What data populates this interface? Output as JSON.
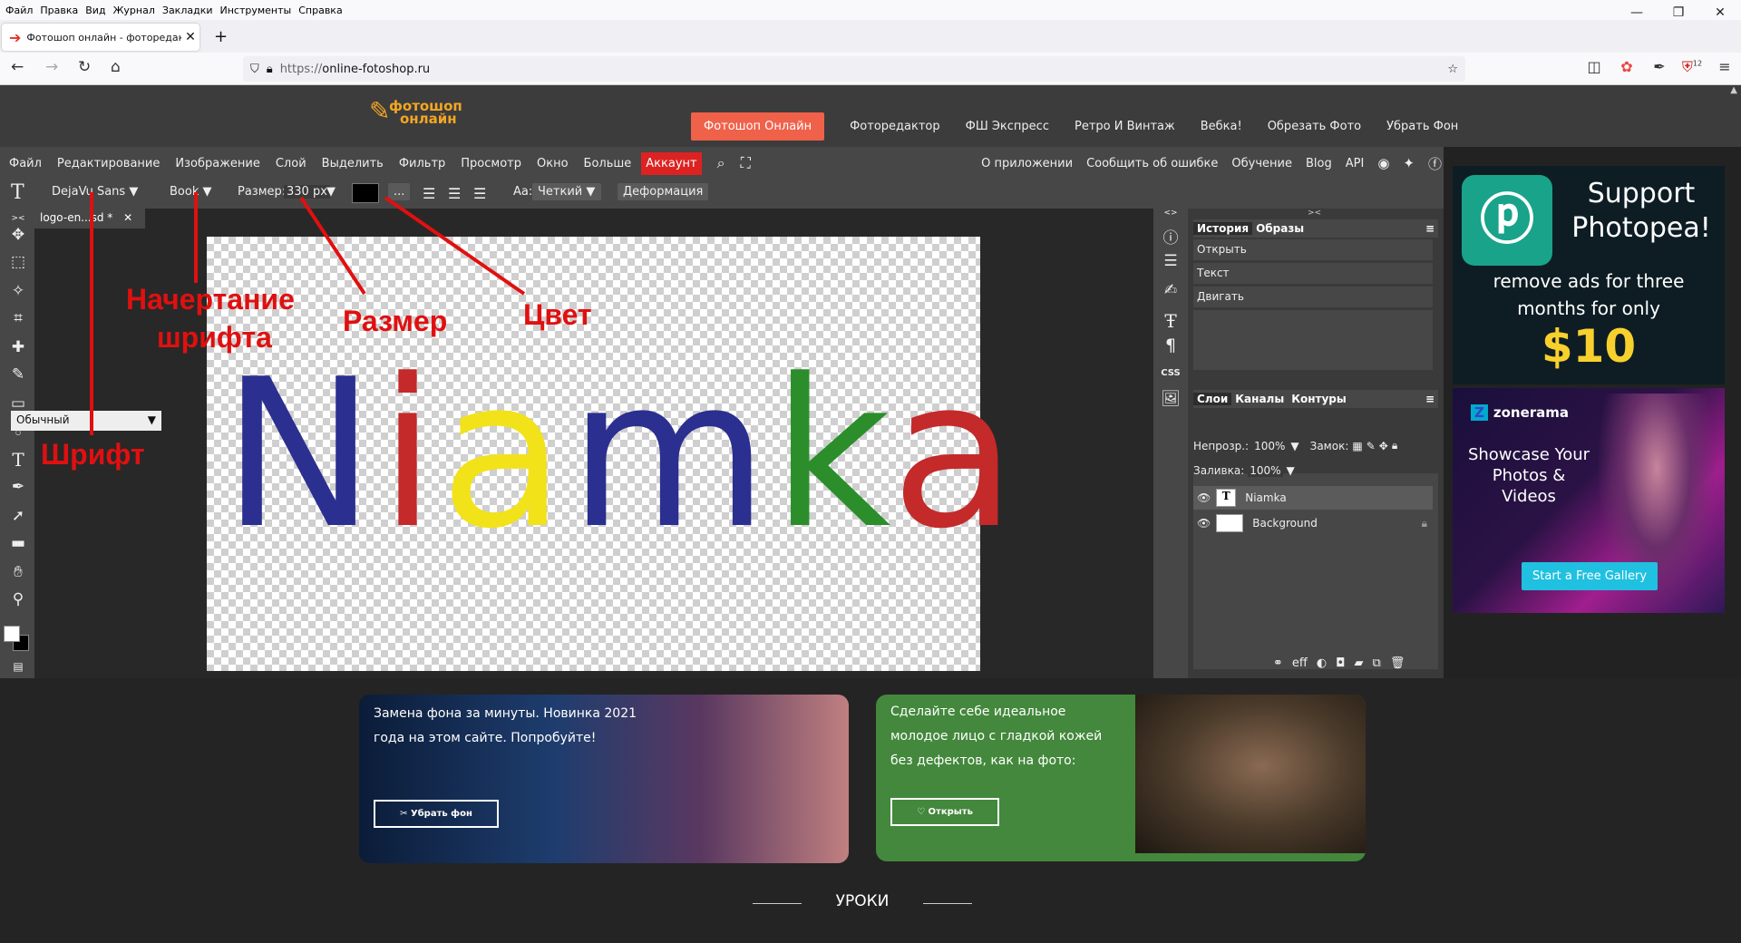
{
  "browser": {
    "menu": [
      "Файл",
      "Правка",
      "Вид",
      "Журнал",
      "Закладки",
      "Инструменты",
      "Справка"
    ],
    "tab_title": "Фотошоп онлайн - фоторедак",
    "url_scheme": "https://",
    "url_host": "online-fotoshop.ru",
    "badge_count": "12"
  },
  "site": {
    "logo_line1": "фотошоп",
    "logo_line2": "онлайн",
    "nav": [
      "Фотошоп Онлайн",
      "Фоторедактор",
      "ФШ Экспресс",
      "Ретро И Винтаж",
      "Вебка!",
      "Обрезать Фото",
      "Убрать Фон"
    ]
  },
  "app": {
    "menu": [
      "Файл",
      "Редактирование",
      "Изображение",
      "Слой",
      "Выделить",
      "Фильтр",
      "Просмотр",
      "Окно",
      "Больше"
    ],
    "account": "Аккаунт",
    "right_links": [
      "О приложении",
      "Сообщить об ошибке",
      "Обучение",
      "Blog",
      "API"
    ]
  },
  "options": {
    "font": "DejaVu Sans ▼",
    "style": "Book ▼",
    "size_label": "Размер:",
    "size_value": "330 px",
    "color_more": "...",
    "aa_label": "Aa:",
    "aa_value": "Четкий",
    "warp": "Деформация"
  },
  "document": {
    "tab": "logo-en...sd *",
    "close": "✕",
    "letters": [
      {
        "ch": "N",
        "color": "#2b2f8f"
      },
      {
        "ch": "i",
        "color": "#c42a2a"
      },
      {
        "ch": "a",
        "color": "#f2e21a"
      },
      {
        "ch": "m",
        "color": "#2b2f8f"
      },
      {
        "ch": "k",
        "color": "#2b8e2b"
      },
      {
        "ch": "a",
        "color": "#c42a2a"
      }
    ]
  },
  "panels": {
    "history_tab": "История",
    "samples_tab": "Образы",
    "history": [
      "Открыть",
      "Текст",
      "Двигать"
    ],
    "layers_tab": "Слои",
    "channels_tab": "Каналы",
    "paths_tab": "Контуры",
    "blend": "Обычный",
    "opacity_label": "Непрозр.:",
    "opacity": "100%",
    "lock_label": "Замок:",
    "fill_label": "Заливка:",
    "fill": "100%",
    "layers": [
      "Niamka",
      "Background"
    ],
    "footer": "eff"
  },
  "ads": {
    "photopea_title": "Support Photopea!",
    "photopea_sub": "remove ads for three months for only",
    "photopea_price": "$10",
    "zonerama_brand": "zonerama",
    "zonerama_text": "Showcase Your Photos & Videos",
    "zonerama_btn": "Start a Free Gallery"
  },
  "promos": {
    "p1_text": "Замена фона за минуты. Новинка 2021 года на этом сайте. Попробуйте!",
    "p1_btn": "Убрать фон",
    "p2_text": "Сделайте себе идеальное молодое лицо с гладкой кожей без дефектов, как на фото:",
    "p2_btn": "Открыть",
    "lessons": "УРОКИ"
  },
  "annotations": {
    "font": "Шрифт",
    "style_line1": "Начертание",
    "style_line2": "шрифта",
    "size": "Размер",
    "color": "Цвет"
  },
  "colors": {
    "accent": "#f0614a",
    "annotation": "#e01010",
    "account": "#dd2222"
  }
}
